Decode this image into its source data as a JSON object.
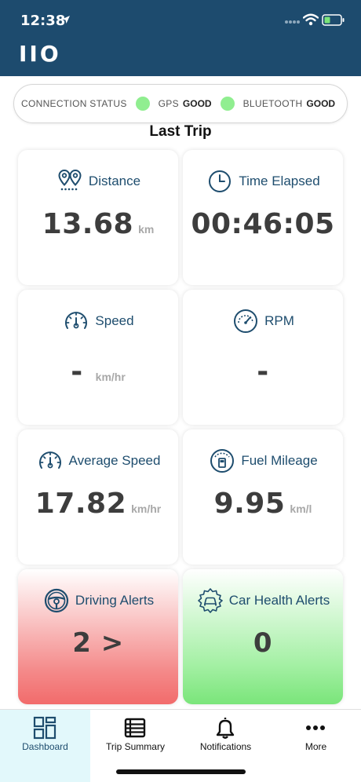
{
  "status_bar": {
    "time": "12:38"
  },
  "app": {
    "logo": "IIO"
  },
  "connection": {
    "label": "CONNECTION STATUS",
    "gps_label": "GPS",
    "gps_value": "GOOD",
    "bt_label": "BLUETOOTH",
    "bt_value": "GOOD",
    "good_color": "#90ee90"
  },
  "section_title": "Last Trip",
  "cards": {
    "distance": {
      "title": "Distance",
      "value": "13.68",
      "unit": "km"
    },
    "time_elapsed": {
      "title": "Time Elapsed",
      "value": "00:46:05"
    },
    "speed": {
      "title": "Speed",
      "value": "-",
      "unit": "km/hr"
    },
    "rpm": {
      "title": "RPM",
      "value": "-"
    },
    "avg_speed": {
      "title": "Average Speed",
      "value": "17.82",
      "unit": "km/hr"
    },
    "fuel_mileage": {
      "title": "Fuel Mileage",
      "value": "9.95",
      "unit": "km/l"
    },
    "driving_alerts": {
      "title": "Driving Alerts",
      "value": "2 >"
    },
    "car_health_alerts": {
      "title": "Car Health Alerts",
      "value": "0"
    }
  },
  "tabs": [
    {
      "label": "Dashboard",
      "icon": "dashboard-icon",
      "active": true
    },
    {
      "label": "Trip Summary",
      "icon": "list-icon"
    },
    {
      "label": "Notifications",
      "icon": "bell-icon"
    },
    {
      "label": "More",
      "icon": "more-icon"
    }
  ],
  "colors": {
    "header": "#1d4b6e",
    "accent": "#1e4d6e",
    "alert_red": "#f26b6b",
    "alert_green": "#7ae57a"
  }
}
